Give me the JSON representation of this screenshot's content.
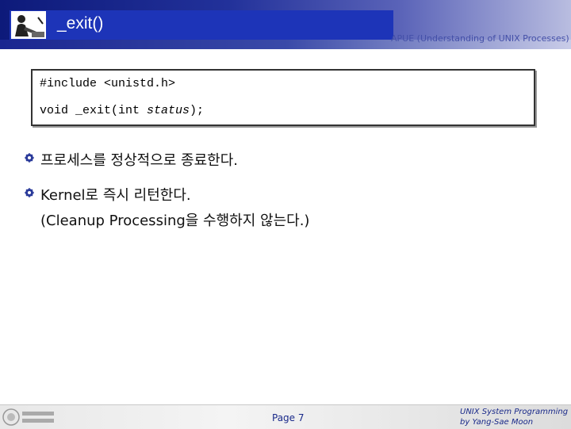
{
  "header": {
    "title": "_exit()",
    "subtitle": "APUE (Understanding of UNIX Processes)"
  },
  "code": {
    "line1": "#include <unistd.h>",
    "line2_prefix": "void _exit(int ",
    "line2_param": "status",
    "line2_suffix": ");"
  },
  "bullets": [
    {
      "text": "프로세스를 정상적으로 종료한다."
    },
    {
      "text": "Kernel로 즉시 리턴한다.",
      "continuation": "(Cleanup Processing을 수행하지 않는다.)"
    }
  ],
  "footer": {
    "page": "Page 7",
    "credit_line1": "UNIX System Programming",
    "credit_line2": "by Yang-Sae Moon"
  },
  "colors": {
    "title_bg": "#1d34b8",
    "accent": "#1a2a8a"
  }
}
